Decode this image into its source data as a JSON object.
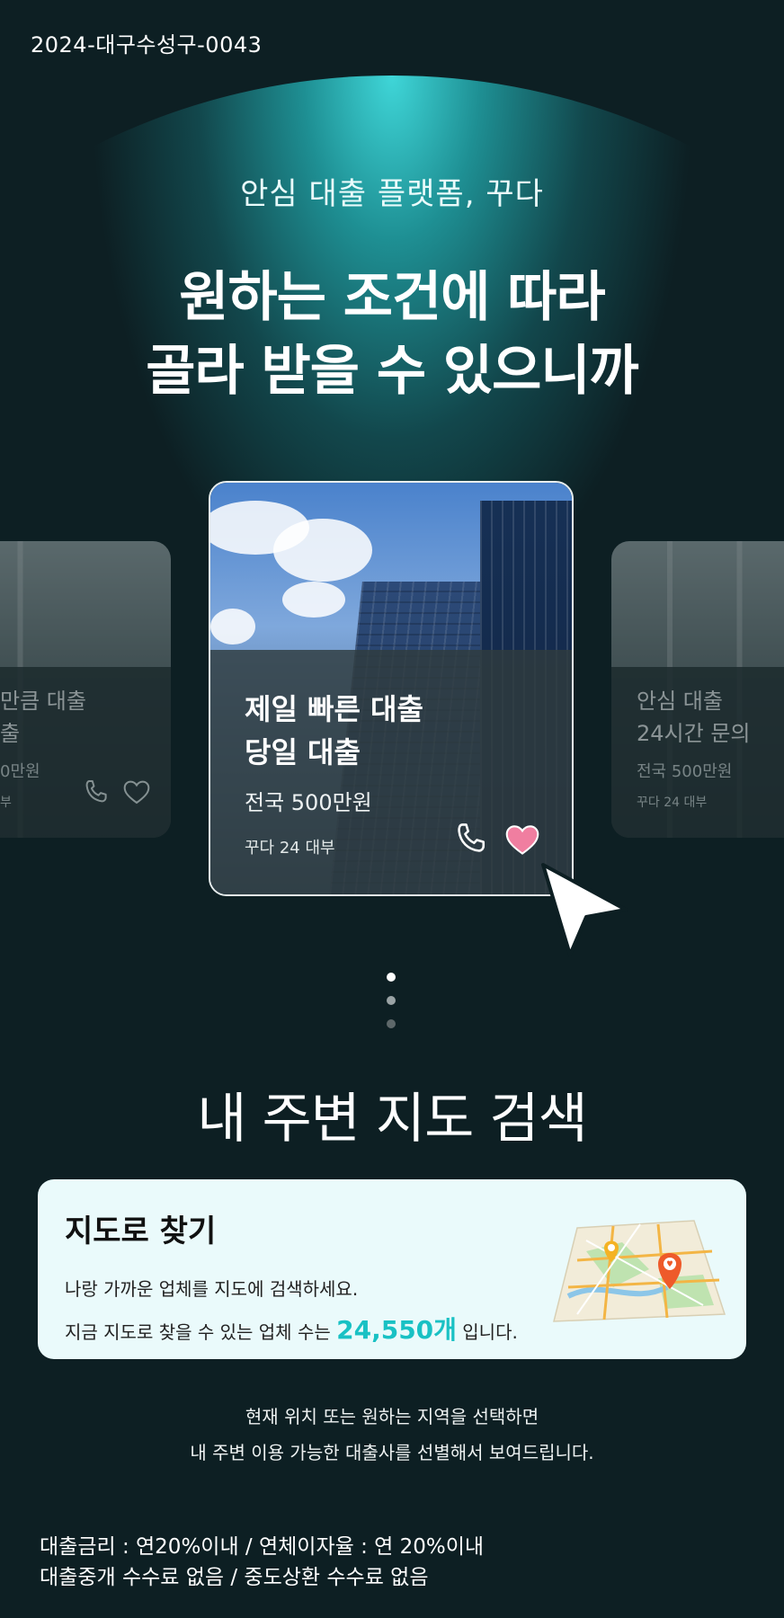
{
  "registration_code": "2024-대구수성구-0043",
  "hero": {
    "subtitle": "안심 대출 플랫폼, 꾸다",
    "title_line1": "원하는 조건에 따라",
    "title_line2": "골라 받을 수 있으니까"
  },
  "carousel": {
    "left_card": {
      "title_line1": "만큼 대출",
      "title_line2": "출",
      "amount": "0만원",
      "company": "부"
    },
    "main_card": {
      "title_line1": "제일 빠른 대출",
      "title_line2": "당일 대출",
      "amount": "전국 500만원",
      "company": "꾸다 24 대부",
      "favorite": true
    },
    "right_card": {
      "title_line1": "안심 대출",
      "title_line2": "24시간 문의",
      "amount": "전국 500만원",
      "company": "꾸다 24 대부"
    },
    "pagination_active_index": 0,
    "pagination_count": 3
  },
  "map_section": {
    "heading": "내 주변 지도 검색",
    "card_title": "지도로 찾기",
    "desc_line1": "나랑 가까운 업체를 지도에 검색하세요.",
    "desc_line2_prefix": "지금 지도로 찾을 수 있는 업체 수는 ",
    "count": "24,550개",
    "desc_line2_suffix": " 입니다.",
    "info_line1": "현재 위치 또는 원하는 지역을 선택하면",
    "info_line2": "내 주변 이용 가능한 대출사를 선별해서 보여드립니다."
  },
  "footer": {
    "line1": "대출금리 : 연20%이내 / 연체이자율 : 연 20%이내",
    "line2": "대출중개 수수료 없음 / 중도상환 수수료 없음"
  },
  "colors": {
    "background": "#0d1f23",
    "accent": "#19c1c4",
    "arc_highlight": "#3fd6d8",
    "heart": "#f07ea0",
    "map_card_bg": "#eafafb"
  },
  "icons": [
    "phone-icon",
    "heart-icon",
    "cursor-icon",
    "map-icon"
  ]
}
